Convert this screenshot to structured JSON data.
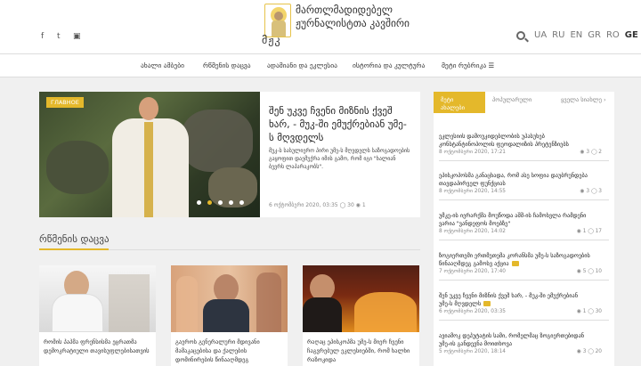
{
  "header": {
    "logo_abbr": "მჟკ",
    "logo_text": "მართლმადიდებელ ჟურნალისტთა კავშირი",
    "languages": [
      "UA",
      "RU",
      "EN",
      "GR",
      "RO",
      "GE"
    ],
    "active_language": "GE"
  },
  "nav": {
    "items": [
      "ახალი ამბები",
      "რწმენის დაცვა",
      "ადამიანი და ეკლესია",
      "ისტორია და კულტურა",
      "მეტი რუბრიკა ☰"
    ]
  },
  "feature": {
    "badge": "ГЛАВНОЕ",
    "title": "შენ უკვე ჩვენი მიზნის ქვეშ ხარ, - მუკ-ში ემუქრებიან უმე-ს მღვდელს",
    "text": "მუკ-ს სასულიერო პირი უმე-ს მღვდელს საზოგადოების გაყოფით დაემუქრა იმის გამო, რომ იგი \"ხალიან ბევრს ლაპარაკობს\".",
    "meta": "6 ოქტომბერი 2020, 03:35  ◯ 30  ◉ 1"
  },
  "section": {
    "title": "რწმენის დაცვა"
  },
  "cards": [
    {
      "title": "რომის პაპმა ფრენსისმა ეცრათმა დემოკრატიული თავისუფლებისათვის"
    },
    {
      "title": "გაეროს გენერალური მდივანი მამაკაცებისა და ქალების დომინირების წინააღმდეგ"
    },
    {
      "title": "რაღაც ეპისკოპმა უმე-ს მიერ ჩვენი ჩაგვრებულ ეკლესიებში, რომ ხალხი რაზოკიდა"
    }
  ],
  "sidebar": {
    "tabs": [
      {
        "label": "მეტი ახალები"
      },
      {
        "label": "პოპულარული"
      },
      {
        "label": "ყველა სიახლე ›"
      }
    ],
    "items": [
      {
        "title": "ეკლესიის დამოუკიდებლობის უპასუხებ კონსტანტინოპოლის ფეოდალიზის პრეტენზიებს",
        "date": "8 ოქტომბერი 2020, 17:21",
        "views": "3",
        "comments": "2",
        "video": false
      },
      {
        "title": "ეპისკოპოსმა განაცხადა, რომ ასე სოფია დაუბრუნდება თავდაპირველ ფუნქციას",
        "date": "8 ოქტომბერი 2020, 14:55",
        "views": "3",
        "comments": "3",
        "video": false
      },
      {
        "title": "უმკე-ის იერარქმა მოუწოდა აშშ-ის ჩამოსვლა რამდენი ვარია \"ვანდეფოს მოებზე\"",
        "date": "8 ოქტომბერი 2020, 14:02",
        "views": "1",
        "comments": "17",
        "video": false
      },
      {
        "title": "ზოგიერთემი ერთმეთემა კორანსმა უმე-ს საზოგადოების წინააღმდეგ გამოსვ აქცია",
        "date": "7 ოქტომბერი 2020, 17:40",
        "views": "5",
        "comments": "10",
        "video": true
      },
      {
        "title": "შენ უკვე ჩვენი მიზნის ქვეშ ხარ, - მუკ-ში ემუქრებიან უმე-ს მღვდელს",
        "date": "6 ოქტომბერი 2020, 03:35",
        "views": "1",
        "comments": "30",
        "video": true
      },
      {
        "title": "ავიამოკ დეპუტატის სამი, რომელმაც ზოგიერთებიდან უმე-ის განდევნა მოითხოვა",
        "date": "5 ოქტომბერი 2020, 18:14",
        "views": "3",
        "comments": "20",
        "video": false
      }
    ]
  },
  "colors": {
    "accent": "#e4b82b"
  }
}
